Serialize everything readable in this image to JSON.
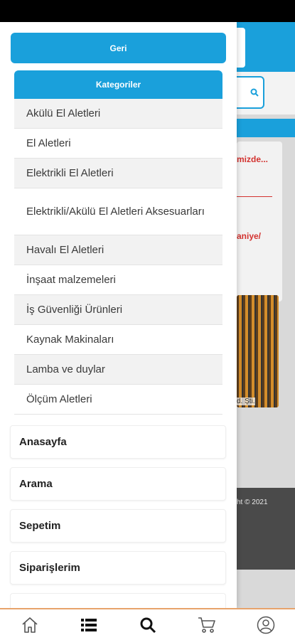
{
  "drawer": {
    "back_label": "Geri",
    "categories_header": "Kategoriler",
    "categories": [
      "Akülü El Aletleri",
      "El Aletleri",
      "Elektrikli El Aletleri",
      "Elektrikli/Akülü El Aletleri Aksesuarları",
      "Havalı El Aletleri",
      "İnşaat malzemeleri",
      "İş Güvenliği Ürünleri",
      "Kaynak Makinaları",
      "Lamba ve duylar",
      "Ölçüm Aletleri"
    ],
    "menu": [
      "Anasayfa",
      "Arama",
      "Sepetim",
      "Siparişlerim"
    ]
  },
  "background": {
    "red_text_1": "mizde...",
    "red_text_2": "aniye/",
    "image_caption": "d. Şti.",
    "copyright": "ht © 2021"
  },
  "bottom_nav": {
    "icons": [
      "home-icon",
      "list-icon",
      "search-icon",
      "cart-icon",
      "user-icon"
    ]
  },
  "colors": {
    "accent": "#1aa0db",
    "alert_red": "#d3322f",
    "nav_border": "#e7a36b"
  }
}
